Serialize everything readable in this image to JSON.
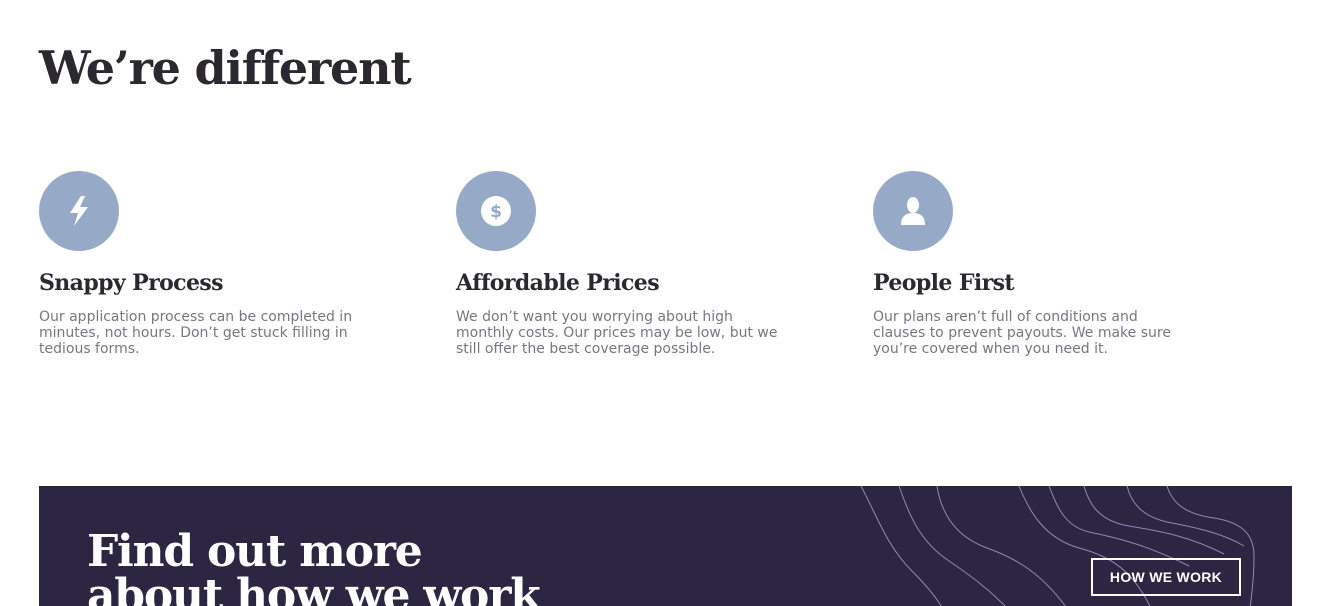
{
  "header": {
    "title": "We’re different"
  },
  "features": [
    {
      "icon": "lightning-icon",
      "heading": "Snappy Process",
      "lines": [
        "Our application process can be completed in",
        "minutes, not hours. Don’t get stuck filling in",
        "tedious forms."
      ]
    },
    {
      "icon": "dollar-icon",
      "heading": "Affordable Prices",
      "lines": [
        "We don’t want you worrying about high",
        "monthly costs. Our prices may be low, but we",
        "still offer the best coverage possible."
      ]
    },
    {
      "icon": "person-icon",
      "heading": "People First",
      "lines": [
        "Our plans aren’t full of conditions and",
        "clauses to prevent payouts. We make sure",
        "you’re covered when you need it."
      ]
    }
  ],
  "cta": {
    "heading_line1": "Find out more",
    "heading_line2": "about how we work",
    "button_label": "HOW WE WORK"
  },
  "colors": {
    "icon_bg": "#96aac8",
    "cta_bg": "#2d2642",
    "heading_text": "#2c2830",
    "body_text": "#7a7581"
  }
}
